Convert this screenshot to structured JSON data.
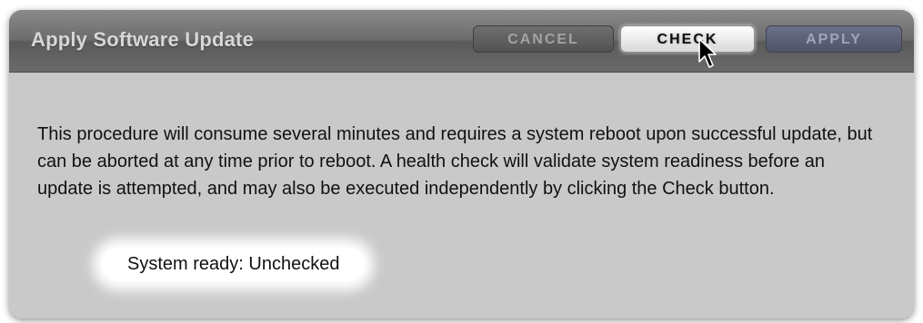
{
  "dialog": {
    "title": "Apply Software Update",
    "buttons": {
      "cancel": "CANCEL",
      "check": "CHECK",
      "apply": "APPLY"
    },
    "description": "This procedure will consume several minutes and requires a system reboot upon successful update, but can be aborted at any time prior to reboot. A health check will validate system readiness before an update is attempted, and may also be executed independently by clicking the Check button.",
    "status": "System ready: Unchecked"
  },
  "colors": {
    "dialog_background": "#c9c9c9",
    "header_dark": "#5a5a5a",
    "apply_button": "#5c6076"
  },
  "icons": {
    "cursor": "mouse-pointer-icon"
  }
}
